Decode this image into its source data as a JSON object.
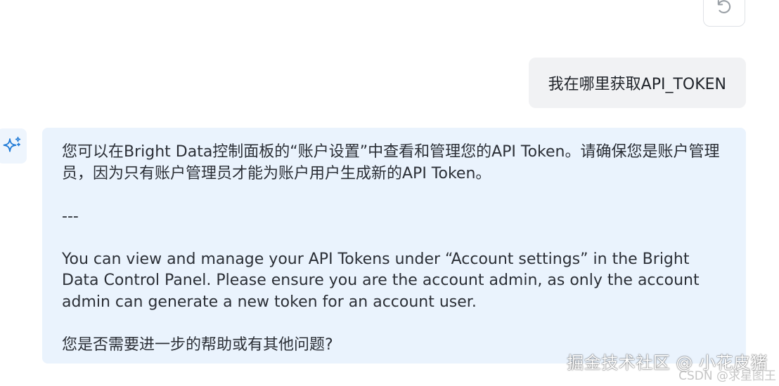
{
  "chat": {
    "refresh_icon": "refresh-icon",
    "user_message": "我在哪里获取API_TOKEN",
    "assistant_icon": "sparkle-icon",
    "assistant_paragraphs": [
      "您可以在Bright Data控制面板的“账户设置”中查看和管理您的API Token。请确保您是账户管理员，因为只有账户管理员才能为账户用户生成新的API Token。",
      "---",
      "You can view and manage your API Tokens under “Account settings” in the Bright Data Control Panel. Please ensure you are the account admin, as only the account admin can generate a new token for an account user.",
      "您是否需要进一步的帮助或有其他问题?"
    ]
  },
  "watermark": {
    "main": "掘金技术社区 @ 小花皮猪",
    "sub": "CSDN @求星图王"
  },
  "colors": {
    "user_bubble_bg": "#f1f2f4",
    "assistant_bubble_bg": "#eaf3fd",
    "accent": "#1f7ad6",
    "text": "#2b2f36"
  }
}
